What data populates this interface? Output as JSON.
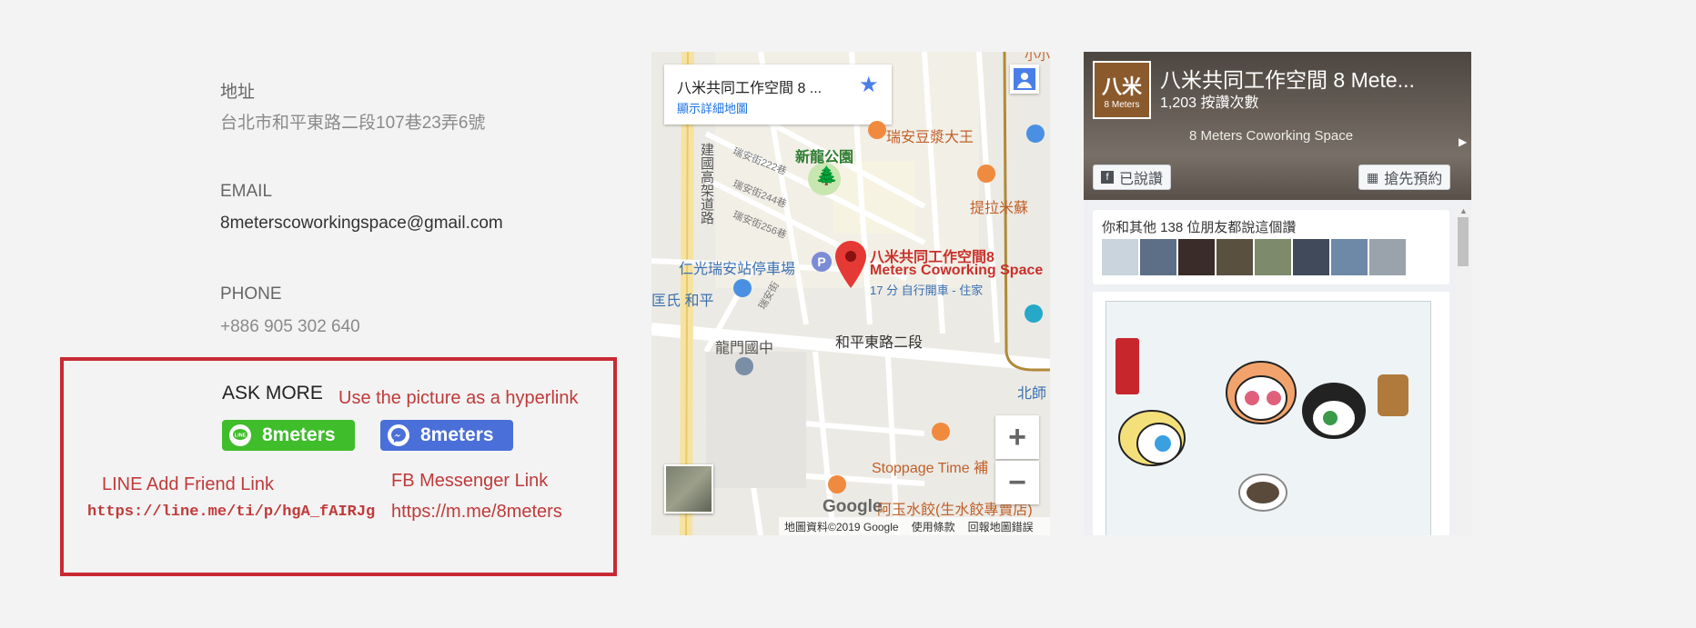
{
  "contact": {
    "address_label": "地址",
    "address_value": "台北市和平東路二段107巷23弄6號",
    "email_label": "EMAIL",
    "email_value": "8meterscoworkingspace@gmail.com",
    "phone_label": "PHONE",
    "phone_value": "+886 905 302 640"
  },
  "ask_more": {
    "title": "ASK MORE",
    "hint": "Use the picture as a hyperlink",
    "line_button": "8meters",
    "messenger_button": "8meters",
    "line_note_title": "LINE Add Friend Link",
    "line_note_url": "https://line.me/ti/p/hgA_fAIRJg",
    "fb_note_title": "FB Messenger Link",
    "fb_note_url": "https://m.me/8meters",
    "line_color": "#3fbd2b",
    "messenger_color": "#4a6fd8"
  },
  "map": {
    "place_title": "八米共同工作空間 8 ...",
    "place_link": "顯示詳細地圖",
    "pin_name_1": "八米共同工作空間8",
    "pin_name_2": "Meters Coworking Space",
    "pin_sub": "17 分 自行開車 - 住家",
    "labels": {
      "park": "新龍公園",
      "parking": "仁光瑞安站停車場",
      "school": "龍門國中",
      "road_main": "和平東路二段",
      "highway": "建國高架道路",
      "street1": "瑞安街222巷",
      "street2": "瑞安街244巷",
      "street3": "瑞安街256巷",
      "street4": "瑞安街",
      "shop1": "瑞安豆漿大王",
      "shop2": "提拉米蘇",
      "shop3": "Stoppage Time 補",
      "shop4": "阿玉水餃(生水餃專賣店)",
      "left_cut": "匡氏 和平",
      "right_cut": "北師",
      "top_cut": "小小餐廳"
    },
    "google": "Google",
    "attribution": "地圖資料©2019 Google",
    "terms": "使用條款",
    "report": "回報地圖錯誤"
  },
  "facebook": {
    "page_name": "八米共同工作空間 8 Mete...",
    "likes": "1,203 按讚次數",
    "cover_text": "8 Meters Coworking Space",
    "logo_text": "8 Meters",
    "liked_button": "已說讚",
    "book_button": "搶先預約",
    "friends_text": "你和其他 138 位朋友都說這個讚"
  }
}
